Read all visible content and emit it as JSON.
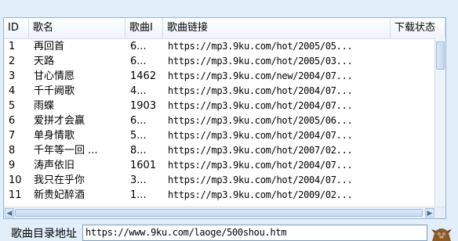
{
  "table": {
    "columns": [
      "ID",
      "歌名",
      "歌曲I",
      "歌曲链接",
      "下载状态"
    ],
    "rows": [
      [
        "1",
        "再回首",
        "6...",
        "https://mp3.9ku.com/hot/2005/05..."
      ],
      [
        "2",
        "天路",
        "6...",
        "https://mp3.9ku.com/hot/2005/03..."
      ],
      [
        "3",
        "甘心情愿",
        "1462",
        "https://mp3.9ku.com/new/2004/07..."
      ],
      [
        "4",
        "千千阙歌",
        "4...",
        "https://mp3.9ku.com/hot/2004/07..."
      ],
      [
        "5",
        "雨蝶",
        "1903",
        "https://mp3.9ku.com/hot/2004/07..."
      ],
      [
        "6",
        "爱拼才会赢",
        "6...",
        "https://mp3.9ku.com/hot/2005/06..."
      ],
      [
        "7",
        "单身情歌",
        "5...",
        "https://mp3.9ku.com/hot/2004/07..."
      ],
      [
        "8",
        "千年等一回 ...",
        "8...",
        "https://mp3.9ku.com/hot/2007/02..."
      ],
      [
        "9",
        "涛声依旧",
        "1601",
        "https://mp3.9ku.com/hot/2004/07..."
      ],
      [
        "10",
        "我只在乎你",
        "3...",
        "https://mp3.9ku.com/hot/2004/07..."
      ],
      [
        "11",
        "新贵妃醉酒",
        "1...",
        "https://mp3.9ku.com/hot/2009/02..."
      ]
    ]
  },
  "footer": {
    "label": "歌曲目录地址",
    "url_value": "https://www.9ku.com/laoge/500shou.htm"
  },
  "scrollbar": {
    "left_arrow": "◀",
    "right_arrow": "▶"
  }
}
